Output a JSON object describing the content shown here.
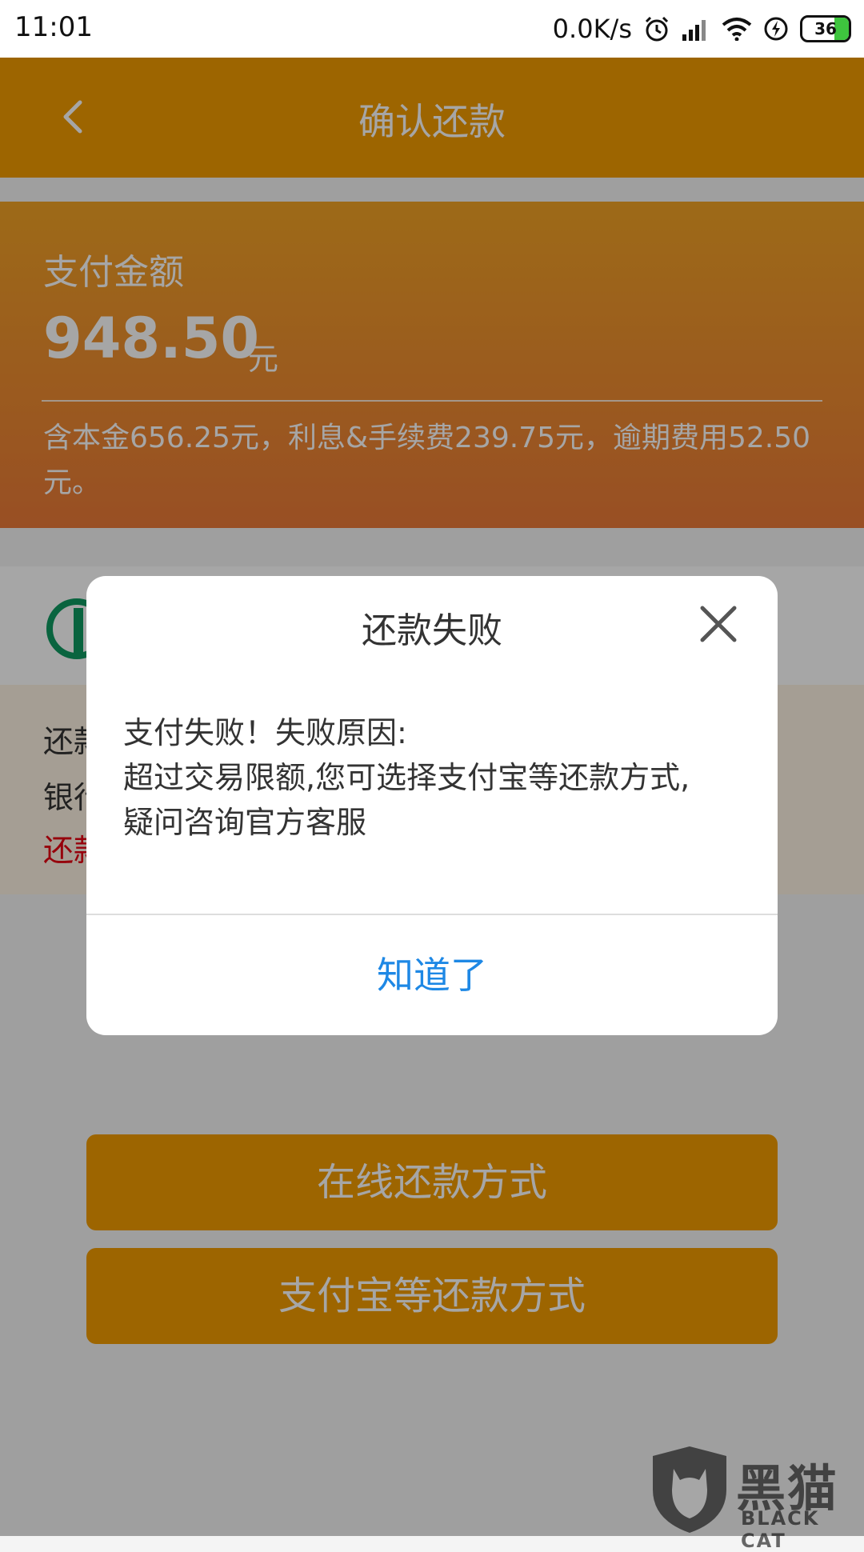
{
  "status_bar": {
    "time": "11:01",
    "net_speed": "0.0K/s",
    "battery": "36",
    "icons": [
      "alarm-icon",
      "signal-icon",
      "wifi-icon",
      "charging-icon",
      "battery-icon"
    ]
  },
  "header": {
    "back_icon": "chevron-left-icon",
    "title": "确认还款"
  },
  "summary": {
    "label": "支付金额",
    "amount": "948.50",
    "unit": "元",
    "detail": "含本金656.25元，利息&手续费239.75元，逾期费用52.50元。"
  },
  "info": {
    "line1": "还款",
    "line2": "银行",
    "line3": "还款"
  },
  "buttons": {
    "online": "在线还款方式",
    "alipay": "支付宝等还款方式"
  },
  "dialog": {
    "title": "还款失败",
    "close_icon": "close-icon",
    "body_line1": "支付失败！失败原因:",
    "body_line2": "超过交易限额,您可选择支付宝等还款方式,",
    "body_line3": "疑问咨询官方客服",
    "ok_label": "知道了"
  },
  "watermark": {
    "cn": "黑猫",
    "en": "BLACK CAT"
  },
  "colors": {
    "brand": "#f29b00",
    "link_blue": "#1e88e5",
    "warning_red": "#e60012",
    "bank_green": "#0e9a61"
  }
}
